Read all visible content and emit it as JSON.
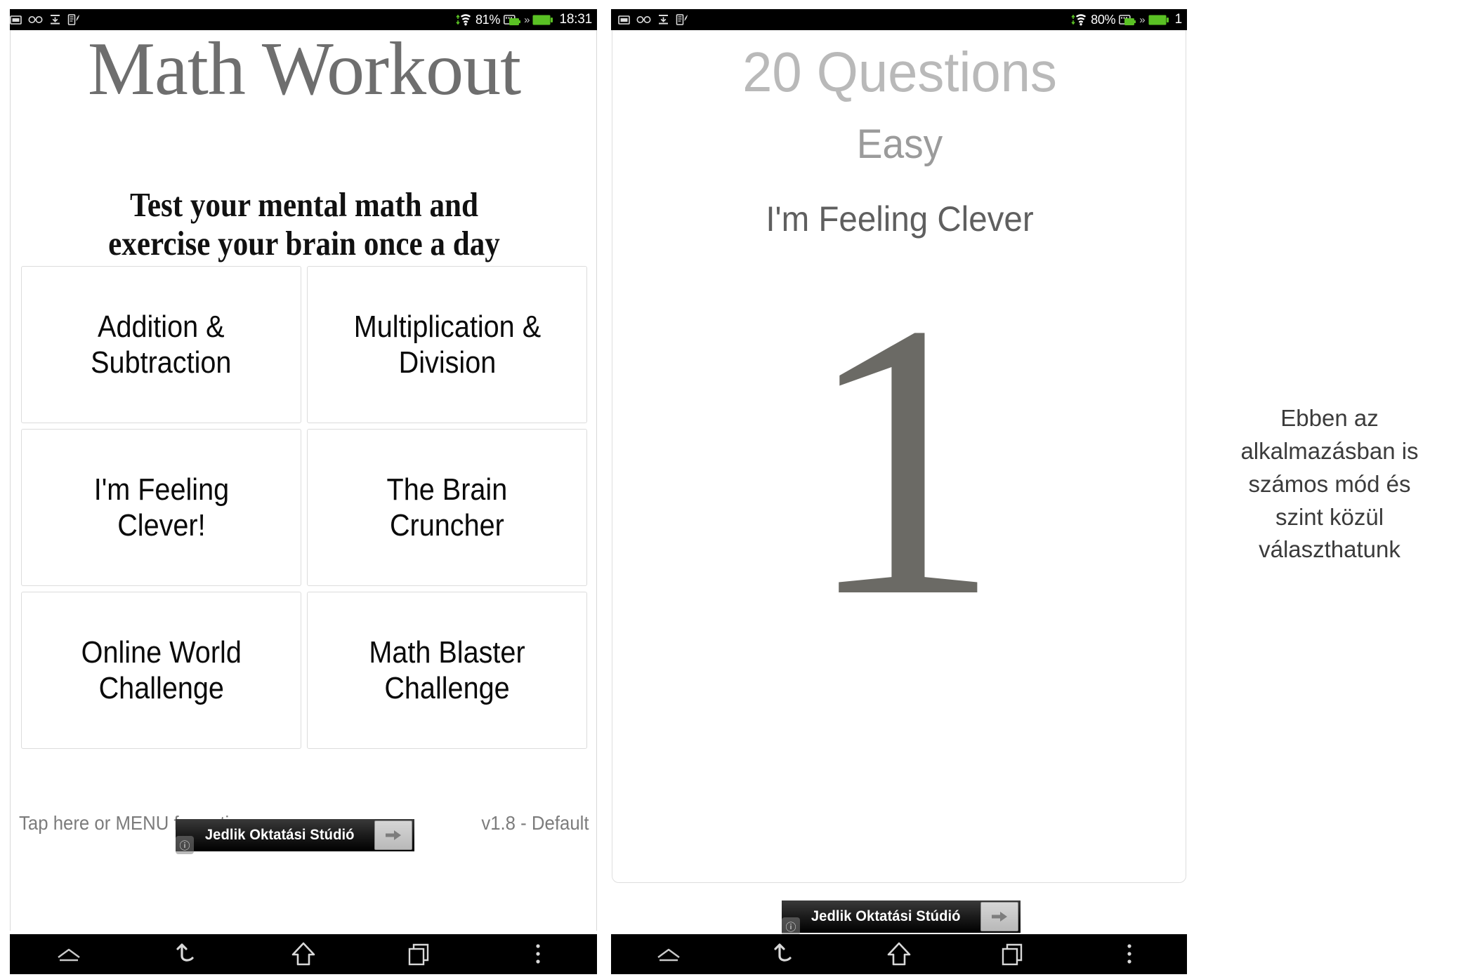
{
  "left_phone": {
    "status_bar": {
      "left_icons": [
        "screenshot-icon",
        "glasses-icon",
        "download-icon",
        "note-pen-icon"
      ],
      "battery_percent": "81%",
      "chevrons": "»",
      "time": "18:31"
    },
    "app_title": "Math Workout",
    "subtitle_line1": "Test your mental math and",
    "subtitle_line2": "exercise your brain once a day",
    "mode_buttons": [
      {
        "line1": "Addition &",
        "line2": "Subtraction"
      },
      {
        "line1": "Multiplication &",
        "line2": "Division"
      },
      {
        "line1": "I'm Feeling",
        "line2": "Clever!"
      },
      {
        "line1": "The Brain",
        "line2": "Cruncher"
      },
      {
        "line1": "Online World",
        "line2": "Challenge"
      },
      {
        "line1": "Math Blaster",
        "line2": "Challenge"
      }
    ],
    "footer_hint": "Tap here or MENU for options",
    "footer_version": "v1.8 - Default",
    "ad": {
      "text": "Jedlik Oktatási Stúdió",
      "info_glyph": "ⓘ"
    },
    "nav_icons": [
      "eject-up-icon",
      "back-arrow-icon",
      "home-icon",
      "recents-icon",
      "overflow-menu-icon"
    ]
  },
  "right_phone": {
    "status_bar": {
      "left_icons": [
        "screenshot-icon",
        "glasses-icon",
        "download-icon",
        "note-pen-icon"
      ],
      "battery_percent": "80%",
      "chevrons": "»",
      "time": "1"
    },
    "quiz_heading": "20 Questions",
    "quiz_level": "Easy",
    "quiz_mode": "I'm Feeling Clever",
    "quiz_number": "1",
    "ad": {
      "text": "Jedlik Oktatási Stúdió",
      "info_glyph": "ⓘ"
    },
    "nav_icons": [
      "eject-up-icon",
      "back-arrow-icon",
      "home-icon",
      "recents-icon",
      "overflow-menu-icon"
    ]
  },
  "caption": {
    "line1": "Ebben az",
    "line2": "alkalmazásban is",
    "line3": "számos mód és",
    "line4": "szint közül",
    "line5": "választhatunk"
  },
  "colors": {
    "title_gray": "#6e6e6e",
    "heading_light_gray": "#b9b9b9",
    "level_gray": "#9b9b9b",
    "mode_gray": "#5f5f5f",
    "number_gray": "#6b6a65",
    "battery_green": "#5ac124",
    "status_bar_black": "#000000"
  }
}
